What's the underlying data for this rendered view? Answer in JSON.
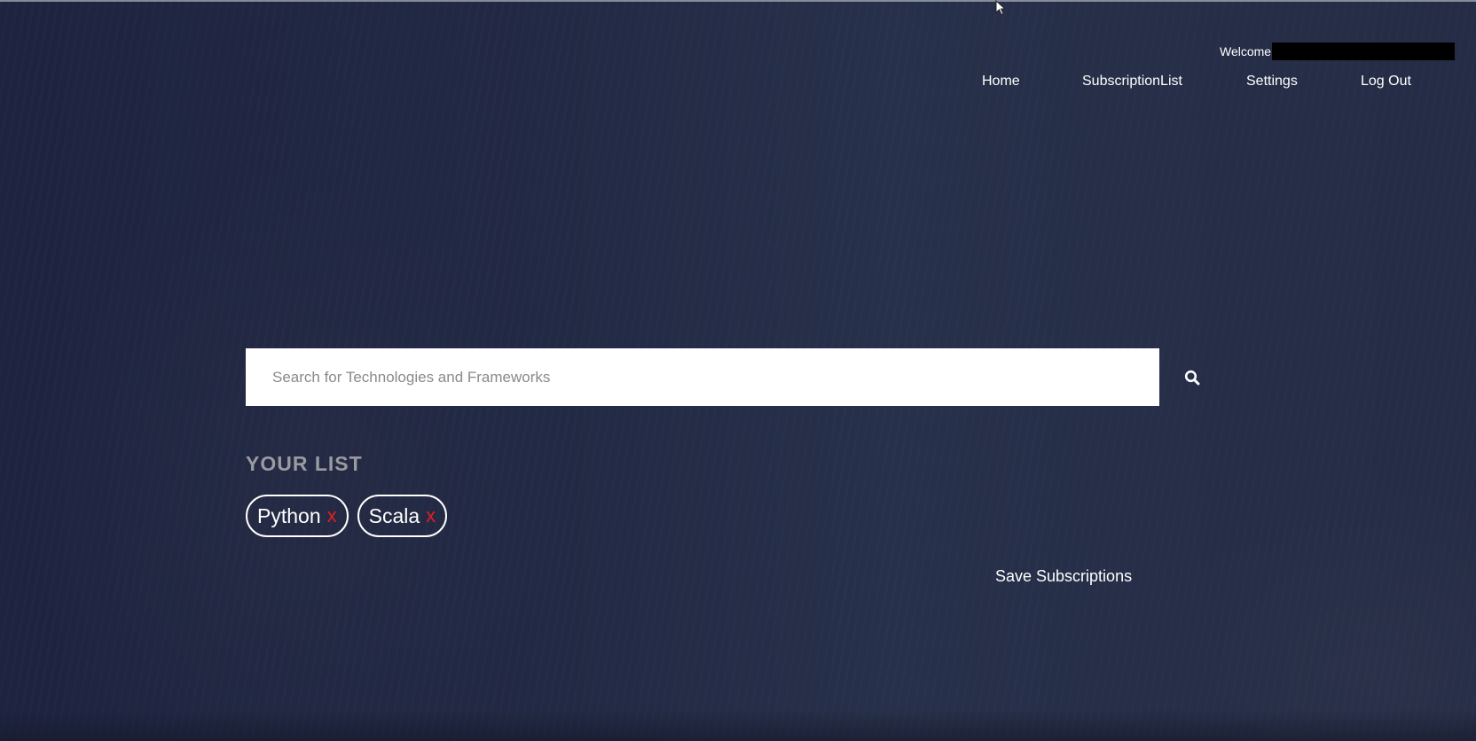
{
  "header": {
    "welcome_label": "Welcome",
    "nav": [
      {
        "label": "Home"
      },
      {
        "label": "SubscriptionList"
      },
      {
        "label": "Settings"
      },
      {
        "label": "Log Out"
      }
    ]
  },
  "search": {
    "placeholder": "Search for Technologies and Frameworks",
    "value": "",
    "icon": "search-icon"
  },
  "list": {
    "title": "YOUR LIST",
    "items": [
      {
        "label": "Python",
        "remove": "x"
      },
      {
        "label": "Scala",
        "remove": "x"
      }
    ]
  },
  "actions": {
    "save_label": "Save Subscriptions"
  },
  "colors": {
    "background": "#23293f",
    "remove_accent": "#e0201e",
    "list_title": "#9a9ba1"
  }
}
